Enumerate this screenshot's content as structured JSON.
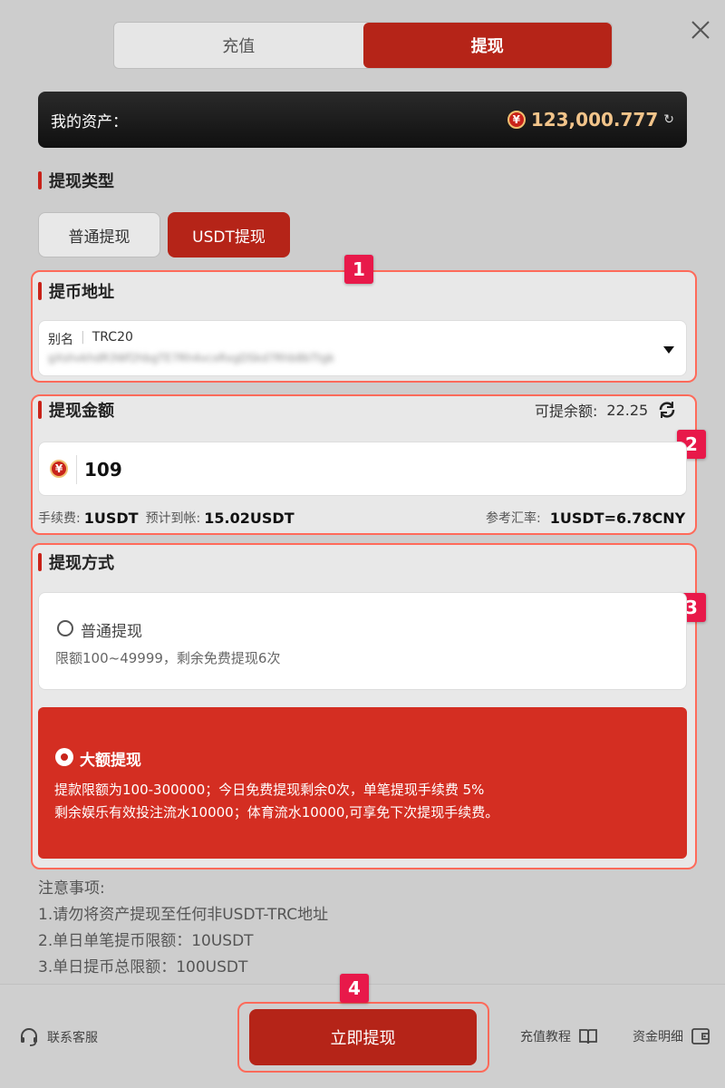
{
  "tabs": [
    {
      "label": "充值"
    },
    {
      "label": "提现"
    }
  ],
  "asset": {
    "label": "我的资产：",
    "currency_symbol": "¥",
    "value": "123,000.777"
  },
  "withdraw_type": {
    "title": "提现类型",
    "options": [
      {
        "label": "普通提现"
      },
      {
        "label": "USDT提现"
      }
    ]
  },
  "address": {
    "title": "提币地址",
    "alias_label": "别名",
    "network": "TRC20",
    "address_blurred": "gXshvkhdR3Wf2hbgTE7Rh4vcxRxgDSkd7Rhb8bTtgk"
  },
  "amount": {
    "title": "提现金额",
    "available_label": "可提余额:",
    "available_value": "22.25",
    "currency_symbol": "¥",
    "input_value": "109",
    "fee_label": "手续费:",
    "fee_value": "1USDT",
    "expected_label": "预计到帐:",
    "expected_value": "15.02USDT",
    "rate_label": "参考汇率:",
    "rate_value": "1USDT=6.78CNY"
  },
  "method": {
    "title": "提现方式",
    "options": [
      {
        "label": "普通提现",
        "desc": "限额100~49999，剩余免费提现6次"
      },
      {
        "label": "大额提现",
        "desc1": "提款限额为100-300000；今日免费提现剩余0次，单笔提现手续费 5%",
        "desc2": "剩余娱乐有效投注流水10000；体育流水10000,可享免下次提现手续费。"
      }
    ]
  },
  "notes": {
    "title": "注意事项:",
    "items": [
      "1.请勿将资产提现至任何非USDT-TRC地址",
      "2.单日单笔提币限额：10USDT",
      "3.单日提币总限额：100USDT"
    ]
  },
  "badges": [
    "1",
    "2",
    "3",
    "4"
  ],
  "footer": {
    "service": "联系客服",
    "submit": "立即提现",
    "tutorial": "充值教程",
    "details": "资金明细"
  },
  "colors": {
    "accent": "#b52418",
    "highlight": "#ff6a5a",
    "badge": "#e8194a"
  }
}
